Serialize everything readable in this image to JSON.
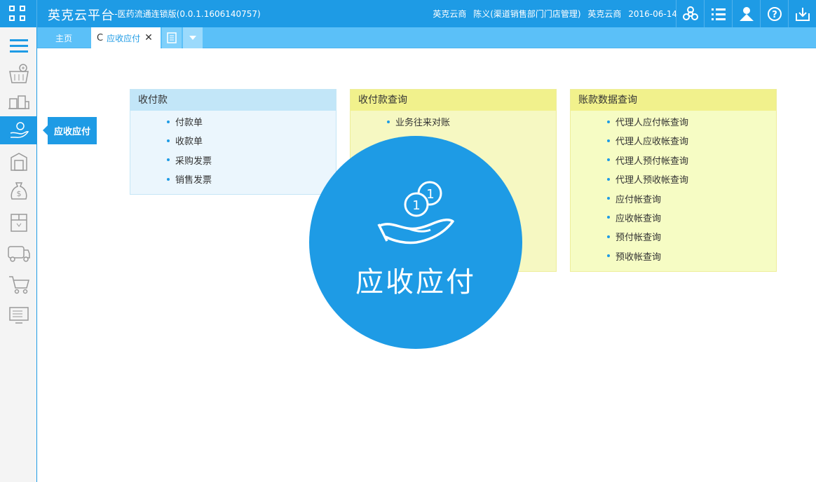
{
  "header": {
    "brand": "英克云平台",
    "subtitle": "--医药流通连锁版(0.0.1.1606140757)",
    "company": "英克云商",
    "user": "陈义(渠道销售部门门店管理)",
    "company2": "英克云商",
    "date": "2016-06-14",
    "icons": [
      "biohazard-icon",
      "list-icon",
      "user-org-icon",
      "help-icon",
      "download-icon"
    ]
  },
  "tabs": {
    "home": "主页",
    "active": "应收应付",
    "active_refresh": "C",
    "active_close": "✕"
  },
  "sidebar": {
    "icons": [
      "menu-icon",
      "pharmacy-basket-icon",
      "warehouse-icon",
      "coin-hand-icon",
      "building-icon",
      "money-bag-icon",
      "box-icon",
      "truck-icon",
      "cart-icon",
      "monitor-icon"
    ],
    "tooltip": "应收应付"
  },
  "panels": [
    {
      "title": "收付款",
      "items": [
        "付款单",
        "收款单",
        "采购发票",
        "销售发票"
      ]
    },
    {
      "title": "收付款查询",
      "items": [
        "业务往来对账"
      ]
    },
    {
      "title": "账款数据查询",
      "items": [
        "代理人应付帐查询",
        "代理人应收帐查询",
        "代理人预付帐查询",
        "代理人预收帐查询",
        "应付帐查询",
        "应收帐查询",
        "预付帐查询",
        "预收帐查询"
      ]
    }
  ],
  "overlay": {
    "title": "应收应付",
    "coin_label": "1"
  },
  "colors": {
    "primary": "#1e9be5",
    "tab_bar": "#5bc0f8",
    "panel_blue": "#c2e6f8",
    "panel_yellow": "#f1f18c"
  }
}
